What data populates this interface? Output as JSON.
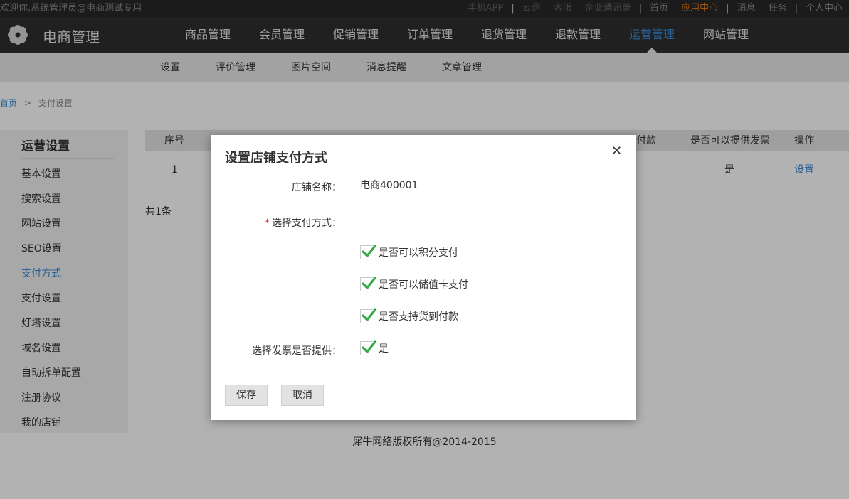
{
  "topbar": {
    "welcome": "欢迎你,系统管理员@电商测试专用",
    "links": [
      {
        "label": "手机APP",
        "style": "dim"
      },
      {
        "label": "|",
        "style": "sep"
      },
      {
        "label": "云盘",
        "style": "dim"
      },
      {
        "label": "客服",
        "style": "dim"
      },
      {
        "label": "企业通讯录",
        "style": "dim"
      },
      {
        "label": "|",
        "style": "sep"
      },
      {
        "label": "首页",
        "style": "normal"
      },
      {
        "label": "应用中心",
        "style": "hl"
      },
      {
        "label": "|",
        "style": "sep"
      },
      {
        "label": "消息",
        "style": "normal"
      },
      {
        "label": "任务",
        "style": "normal"
      },
      {
        "label": "|",
        "style": "sep"
      },
      {
        "label": "个人中心",
        "style": "normal"
      }
    ]
  },
  "header": {
    "logo_icon": "gear-icon",
    "title": "电商管理",
    "nav": [
      {
        "label": "商品管理",
        "active": false
      },
      {
        "label": "会员管理",
        "active": false
      },
      {
        "label": "促销管理",
        "active": false
      },
      {
        "label": "订单管理",
        "active": false
      },
      {
        "label": "退货管理",
        "active": false
      },
      {
        "label": "退款管理",
        "active": false
      },
      {
        "label": "运营管理",
        "active": true
      },
      {
        "label": "网站管理",
        "active": false
      }
    ]
  },
  "subnav": {
    "items": [
      {
        "label": "设置",
        "active": true
      },
      {
        "label": "评价管理",
        "active": false
      },
      {
        "label": "图片空间",
        "active": false
      },
      {
        "label": "消息提醒",
        "active": false
      },
      {
        "label": "文章管理",
        "active": false
      }
    ]
  },
  "breadcrumb": {
    "home": "首页",
    "separator": ">",
    "current": "支付设置"
  },
  "sidebar": {
    "title": "运营设置",
    "items": [
      {
        "label": "基本设置",
        "active": false
      },
      {
        "label": "搜索设置",
        "active": false
      },
      {
        "label": "网站设置",
        "active": false
      },
      {
        "label": "SEO设置",
        "active": false
      },
      {
        "label": "支付方式",
        "active": true
      },
      {
        "label": "支付设置",
        "active": false
      },
      {
        "label": "灯塔设置",
        "active": false
      },
      {
        "label": "域名设置",
        "active": false
      },
      {
        "label": "自动拆单配置",
        "active": false
      },
      {
        "label": "注册协议",
        "active": false
      },
      {
        "label": "我的店铺",
        "active": false
      }
    ]
  },
  "table": {
    "headers": {
      "index": "序号",
      "cod_partial": "付款",
      "invoice": "是否可以提供发票",
      "action": "操作"
    },
    "rows": [
      {
        "index": "1",
        "invoice": "是",
        "action": "设置"
      }
    ],
    "total": "共1条"
  },
  "footer": "犀牛网络版权所有@2014-2015",
  "dialog": {
    "title": "设置店铺支付方式",
    "close_icon": "close-icon",
    "store_label": "店铺名称：",
    "store_value": "电商400001",
    "payment_required_mark": "*",
    "payment_label": "选择支付方式：",
    "options": [
      {
        "label": "是否可以积分支付",
        "checked": true
      },
      {
        "label": "是否可以储值卡支付",
        "checked": true
      },
      {
        "label": "是否支持货到付款",
        "checked": true
      }
    ],
    "invoice_label": "选择发票是否提供：",
    "invoice_option": {
      "label": "是",
      "checked": true
    },
    "save_label": "保存",
    "cancel_label": "取消"
  },
  "colors": {
    "accent": "#3a8ad6",
    "highlight": "#e07b16",
    "check": "#3aa845",
    "required": "#e0302b"
  }
}
